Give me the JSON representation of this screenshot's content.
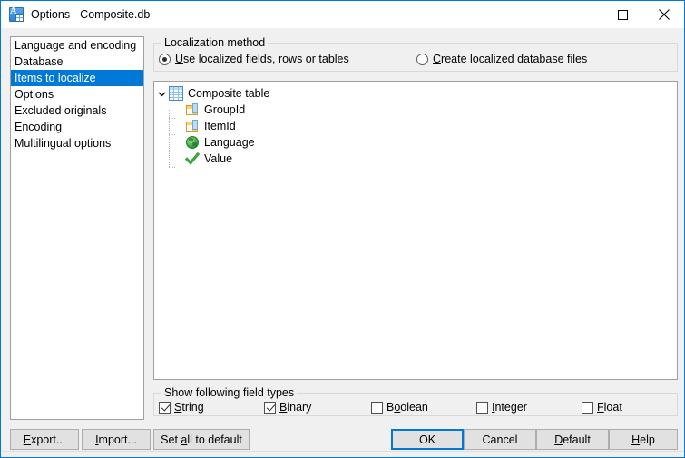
{
  "window": {
    "title": "Options - Composite.db",
    "app_icon": "app-translate-table-icon",
    "accent_color": "#0078d7",
    "controls": {
      "minimize": "minimize-icon",
      "maximize": "maximize-icon",
      "close": "close-icon"
    }
  },
  "sidebar": {
    "items": [
      {
        "label": "Language and encoding",
        "selected": false
      },
      {
        "label": "Database",
        "selected": false
      },
      {
        "label": "Items to localize",
        "selected": true
      },
      {
        "label": "Options",
        "selected": false
      },
      {
        "label": "Excluded originals",
        "selected": false
      },
      {
        "label": "Encoding",
        "selected": false
      },
      {
        "label": "Multilingual options",
        "selected": false
      }
    ]
  },
  "localization_method": {
    "group_label": "Localization method",
    "options": [
      {
        "label": "Use localized fields, rows or tables",
        "accelerator": "U",
        "prefix": "",
        "suffix": "se localized fields, rows or tables",
        "checked": true
      },
      {
        "label": "Create localized database files",
        "accelerator": "C",
        "prefix": "",
        "suffix": "reate localized database files",
        "checked": false
      }
    ]
  },
  "tree": {
    "root": {
      "label": "Composite table",
      "icon": "table-icon",
      "expanded": true,
      "expander_icon": "chevron-down-icon"
    },
    "children": [
      {
        "label": "GroupId",
        "icon": "field-icon"
      },
      {
        "label": "ItemId",
        "icon": "field-icon"
      },
      {
        "label": "Language",
        "icon": "globe-icon"
      },
      {
        "label": "Value",
        "icon": "check-icon"
      }
    ]
  },
  "field_types": {
    "group_label": "Show following field types",
    "items": [
      {
        "label": "String",
        "accelerator": "S",
        "prefix": "",
        "suffix": "tring",
        "checked": true
      },
      {
        "label": "Binary",
        "accelerator": "B",
        "prefix": "",
        "suffix": "inary",
        "checked": true
      },
      {
        "label": "Boolean",
        "accelerator": "o",
        "prefix": "B",
        "suffix": "olean",
        "checked": false
      },
      {
        "label": "Integer",
        "accelerator": "I",
        "prefix": "",
        "suffix": "nteger",
        "checked": false
      },
      {
        "label": "Float",
        "accelerator": "F",
        "prefix": "",
        "suffix": "loat",
        "checked": false
      }
    ]
  },
  "buttons": {
    "left": [
      {
        "label": "Export...",
        "accelerator": "E",
        "prefix": "",
        "suffix": "xport...",
        "default": false
      },
      {
        "label": "Import...",
        "accelerator": "I",
        "prefix": "",
        "suffix": "mport...",
        "default": false
      },
      {
        "label": "Set all to default",
        "accelerator": "a",
        "prefix": "Set ",
        "suffix": "ll to default",
        "default": false
      }
    ],
    "right": [
      {
        "label": "OK",
        "accelerator": "",
        "prefix": "OK",
        "suffix": "",
        "default": true
      },
      {
        "label": "Cancel",
        "accelerator": "",
        "prefix": "Cancel",
        "suffix": "",
        "default": false
      },
      {
        "label": "Default",
        "accelerator": "D",
        "prefix": "",
        "suffix": "efault",
        "default": false
      },
      {
        "label": "Help",
        "accelerator": "H",
        "prefix": "",
        "suffix": "elp",
        "default": false
      }
    ]
  }
}
